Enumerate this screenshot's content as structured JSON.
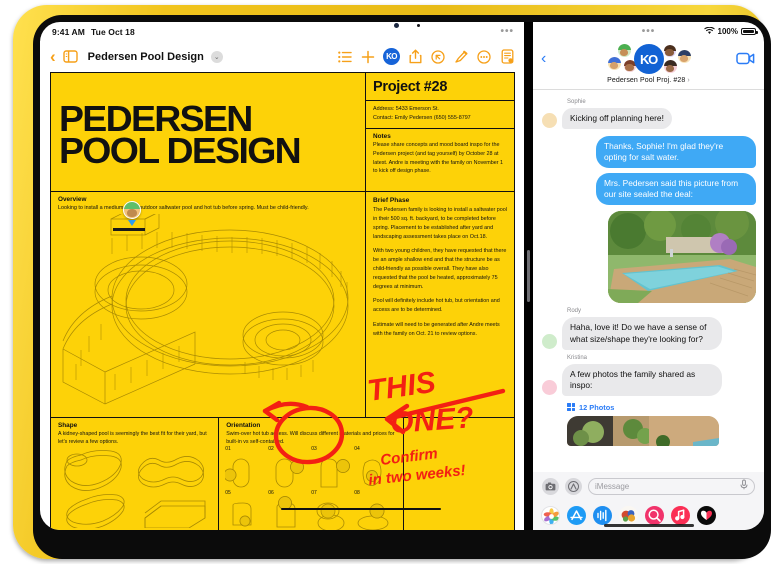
{
  "device": {
    "body_color": "#f1c41d",
    "screen_bg": "#000000"
  },
  "left_pane": {
    "status_bar": {
      "time": "9:41 AM",
      "date": "Tue Oct 18",
      "dots": "•••"
    },
    "toolbar": {
      "back_label": "‹",
      "sidebar_icon": "sidebar-icon",
      "title": "Pedersen Pool Design",
      "caret": "⌄",
      "icons": [
        "list-icon",
        "add-icon",
        "collaboration-icon",
        "share-icon",
        "undo-icon",
        "markup-icon",
        "more-icon",
        "document-options-icon"
      ],
      "collab_initials": "KO"
    },
    "document": {
      "title_line1": "PEDERSEN",
      "title_line2": "POOL DESIGN",
      "project_title": "Project #28",
      "address": "Address: 5433 Emerson St.",
      "contact": "Contact: Emily Pedersen (650) 555-8797",
      "notes_heading": "Notes",
      "notes_body": "Please share concepts and mood board inspo for the Pedersen project (and tag yourself) by October 28 at latest. Andre is meeting with the family on November 1 to kick off design phase.",
      "overview_heading": "Overview",
      "overview_body": "Looking to install a medium-sized outdoor saltwater pool and hot tub before spring. Must be child-friendly.",
      "brief_heading": "Brief Phase",
      "brief_p1": "The Pedersen family is looking to install a saltwater pool in their 500 sq. ft. backyard, to be completed before spring. Placement to be established after yard and landscaping assessment takes place on Oct.18.",
      "brief_p2": "With two young children, they have requested that there be an ample shallow end and that the structure be as child-friendly as possible overall. They have also requested that the pool be heated, approximately 75 degrees at minimum.",
      "brief_p3": "Pool will definitely include hot tub, but orientation and access are to be determined.",
      "brief_p4": "Estimate will need to be generated after Andre meets with the family on Oct. 21 to review options.",
      "shape_heading": "Shape",
      "shape_body": "A kidney-shaped pool is seemingly the best fit for their yard, but let's review a few options.",
      "orientation_heading": "Orientation",
      "orientation_body": "Swim-over hot tub access. Will discuss different materials and prices for built-in vs self-contained.",
      "orientation_numbers": [
        "01",
        "02",
        "03",
        "04",
        "05",
        "06",
        "07",
        "08"
      ],
      "annotation_line1": "THIS",
      "annotation_line2": "ONE?",
      "annotation_line3": "Confirm",
      "annotation_line4": "in two weeks!",
      "ink_color": "#f32013",
      "page_color": "#fdd208"
    },
    "collaborator_cursor": {
      "name": "collaborator-avatar"
    }
  },
  "right_pane": {
    "status_bar": {
      "dots": "•••",
      "battery_pct": "100%",
      "wifi_icon": "wifi-icon"
    },
    "header": {
      "back_label": "‹",
      "group_initials": "KO",
      "group_title": "Pedersen Pool Proj. #28",
      "chevron": "›",
      "facetime_icon": "video-camera-icon"
    },
    "messages": [
      {
        "sender": "Sophie",
        "text": "Kicking off planning here!",
        "out": false
      },
      {
        "sender": "",
        "text": "Thanks, Sophie! I'm glad they're opting for salt water.",
        "out": true
      },
      {
        "sender": "",
        "text": "Mrs. Pedersen said this picture from our site sealed the deal:",
        "out": true
      },
      {
        "sender": "",
        "text": "",
        "out": true,
        "photo": "pool-photo"
      },
      {
        "sender": "Rody",
        "text": "Haha, love it! Do we have a sense of what size/shape they're looking for?",
        "out": false
      },
      {
        "sender": "Kristina",
        "text": "A few photos the family shared as inspo:",
        "out": false
      }
    ],
    "photos_attachment": {
      "label": "12 Photos",
      "icon": "photo-grid-icon"
    },
    "composer": {
      "camera_icon": "camera-icon",
      "apps_icon": "app-store-icon",
      "placeholder": "iMessage",
      "mic_icon": "microphone-icon"
    },
    "app_drawer": [
      "photos-app-icon",
      "app-store-icon",
      "audio-app-icon",
      "memoji-app-icon",
      "images-app-icon",
      "music-app-icon",
      "digital-touch-icon"
    ]
  }
}
